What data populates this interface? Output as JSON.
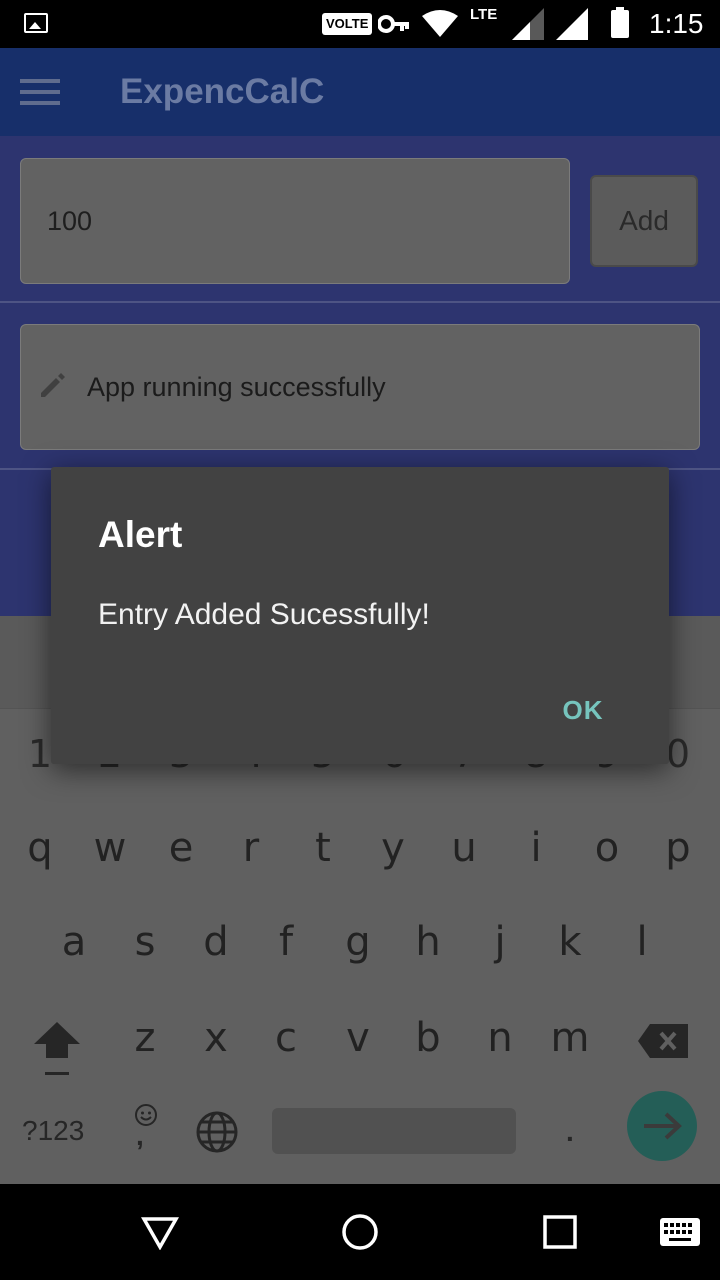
{
  "status_bar": {
    "volte": "VOLTE",
    "lte": "LTE",
    "time": "1:15",
    "icons": [
      "gallery-icon",
      "key-icon",
      "wifi-icon",
      "signal-icon",
      "battery-icon"
    ]
  },
  "app_bar": {
    "title": "ExpencCalC",
    "menu_icon": "hamburger-menu-icon"
  },
  "form": {
    "amount_value": "100",
    "add_label": "Add",
    "note_icon": "pencil-icon",
    "note_value": "App running successfully"
  },
  "keyboard": {
    "numbers": [
      "1",
      "2",
      "3",
      "4",
      "5",
      "6",
      "7",
      "8",
      "9",
      "0"
    ],
    "row1": [
      "q",
      "w",
      "e",
      "r",
      "t",
      "y",
      "u",
      "i",
      "o",
      "p"
    ],
    "row2": [
      "a",
      "s",
      "d",
      "f",
      "g",
      "h",
      "j",
      "k",
      "l"
    ],
    "row3": [
      "z",
      "x",
      "c",
      "v",
      "b",
      "n",
      "m"
    ],
    "symbols_label": "?123",
    "comma": ",",
    "period": ".",
    "icons": [
      "shift-icon",
      "backspace-icon",
      "emoji-icon",
      "globe-icon",
      "enter-arrow-icon"
    ]
  },
  "nav_bar": {
    "icons": [
      "back-icon",
      "home-icon",
      "recents-icon",
      "keyboard-switch-icon"
    ]
  },
  "dialog": {
    "title": "Alert",
    "message": "Entry Added Sucessfully!",
    "ok_label": "OK",
    "accent": "#76c4bd"
  }
}
